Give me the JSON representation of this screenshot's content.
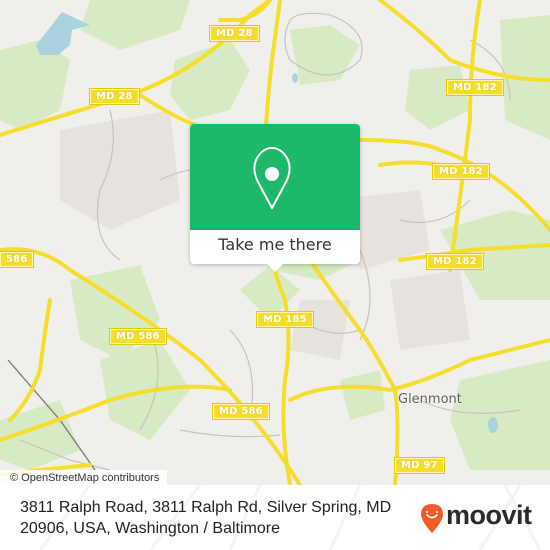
{
  "map": {
    "attribution": "© OpenStreetMap contributors",
    "road_labels": [
      {
        "id": "md28-top",
        "text": "MD 28"
      },
      {
        "id": "md28-left",
        "text": "MD 28"
      },
      {
        "id": "md182-a",
        "text": "MD 182"
      },
      {
        "id": "md182-b",
        "text": "MD 182"
      },
      {
        "id": "md182-c",
        "text": "MD 182"
      },
      {
        "id": "md586-left",
        "text": "586"
      },
      {
        "id": "md586-mid",
        "text": "MD 586"
      },
      {
        "id": "md586-bottom",
        "text": "MD 586"
      },
      {
        "id": "md185",
        "text": "MD 185"
      },
      {
        "id": "md97",
        "text": "MD 97"
      }
    ],
    "place_labels": [
      {
        "id": "glenmont",
        "text": "Glenmont"
      }
    ],
    "colors": {
      "land": "#f1efec",
      "park": "#cfe6b4",
      "water": "#aad3df",
      "major_road": "#f5dd2c",
      "minor_road": "#bdb9b5"
    }
  },
  "popup": {
    "icon": "map-pin-icon",
    "button_label": "Take me there",
    "color": "#1db86a"
  },
  "footer": {
    "address": "3811 Ralph Road, 3811 Ralph Rd, Silver Spring, MD 20906, USA, Washington / Baltimore",
    "brand": "moovit",
    "brand_color": "#f15a29"
  }
}
